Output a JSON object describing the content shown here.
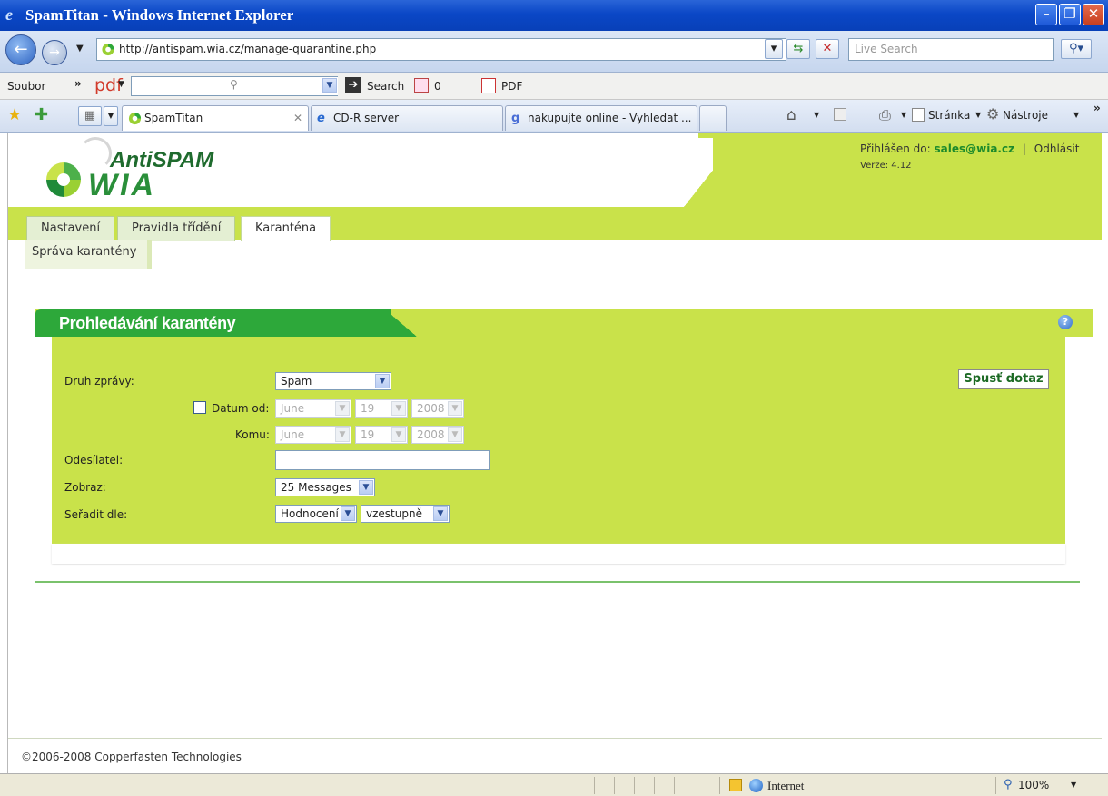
{
  "window": {
    "title": "SpamTitan - Windows Internet Explorer"
  },
  "addressbar": {
    "url": "http://antispam.wia.cz/manage-quarantine.php",
    "search_placeholder": "Live Search"
  },
  "toolbar": {
    "file_menu": "Soubor",
    "chevron": "»",
    "pdf_label": "pdf",
    "search_label": "Search",
    "count": "0",
    "pdf_button": "PDF"
  },
  "tabs": [
    {
      "label": "SpamTitan"
    },
    {
      "label": "CD-R server"
    },
    {
      "label": "nakupujte online - Vyhledat ..."
    }
  ],
  "commandbar": {
    "page": "Stránka",
    "tools": "Nástroje"
  },
  "header": {
    "logo_top": "AntiSPAM",
    "logo_bottom": "WIA",
    "logged_in_label": "Přihlášen do:",
    "user_email": "sales@wia.cz",
    "separator": "|",
    "logout": "Odhlásit",
    "version": "Verze: 4.12"
  },
  "nav": {
    "tabs": [
      {
        "label": "Nastavení"
      },
      {
        "label": "Pravidla třídění"
      },
      {
        "label": "Karanténa"
      }
    ],
    "subnav": "Správa karantény"
  },
  "panel": {
    "title": "Prohledávání karantény",
    "help": "?",
    "message_type_label": "Druh zprávy:",
    "message_type_value": "Spam",
    "date_from_label": "Datum od:",
    "date_to_label": "Komu:",
    "date_month": "June",
    "date_day": "19",
    "date_year": "2008",
    "sender_label": "Odesílatel:",
    "sender_value": "",
    "show_label": "Zobraz:",
    "show_value": "25 Messages",
    "sort_label": "Seřadit dle:",
    "sort_field": "Hodnocení",
    "sort_order": "vzestupně",
    "run_button": "Spusť dotaz"
  },
  "footer": {
    "copyright": "©2006-2008 Copperfasten Technologies"
  },
  "statusbar": {
    "zone": "Internet",
    "zoom": "100%"
  },
  "colors": {
    "brand_green": "#2da83a",
    "lime": "#c9e24a"
  }
}
